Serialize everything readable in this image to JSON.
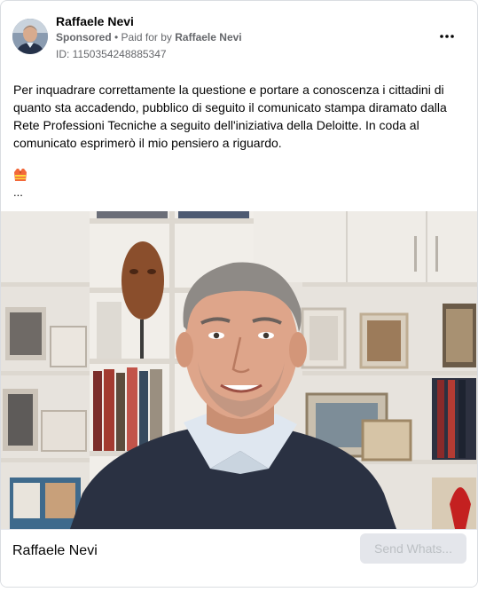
{
  "post": {
    "author_name": "Raffaele Nevi",
    "sponsored_label": "Sponsored",
    "separator": " • ",
    "paid_for_prefix": "Paid for by ",
    "paid_for_name": "Raffaele Nevi",
    "ad_id": "ID: 1150354248885347",
    "more_icon": "more-horizontal-icon",
    "text": "Per inquadrare correttamente la questione e portare a conoscenza i cittadini di quanto sta accadendo, pubblico di seguito il comunicato stampa diramato dalla Rete Professioni Tecniche a seguito dell'iniziativa della Deloitte. In coda al comunicato esprimerò il mio pensiero a riguardo.",
    "emoji_icon": "safety-vest-icon",
    "truncation": "..."
  },
  "footer": {
    "name": "Raffaele Nevi",
    "cta_label": "Send Whats..."
  },
  "colors": {
    "muted_text": "#65676b",
    "cta_bg": "#e4e6eb",
    "cta_text": "#bcc0c4"
  }
}
